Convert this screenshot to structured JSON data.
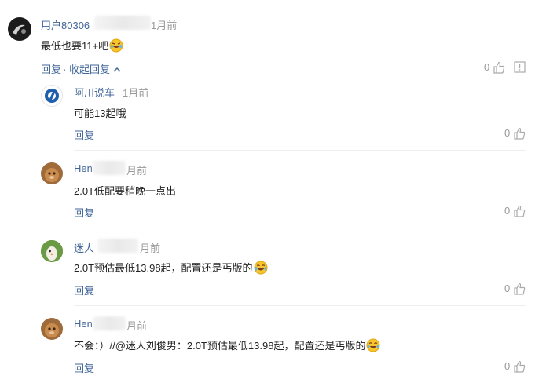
{
  "main_comment": {
    "user": "用户80306",
    "time": "1月前",
    "text": "最低也要11+吧",
    "reply_label": "回复",
    "collapse_label": "· 收起回复",
    "likes": "0"
  },
  "replies": [
    {
      "user": "阿川说车",
      "time": "1月前",
      "text": "可能13起哦",
      "reply_label": "回复",
      "likes": "0"
    },
    {
      "user": "Hen",
      "time": "月前",
      "text": "2.0T低配要稍晚一点出",
      "reply_label": "回复",
      "likes": "0"
    },
    {
      "user": "迷人",
      "time": "月前",
      "text": "2.0T预估最低13.98起，配置还是丐版的",
      "reply_label": "回复",
      "likes": "0"
    },
    {
      "user": "Hen",
      "time": "月前",
      "text": "不会：）//@迷人刘俊男：2.0T预估最低13.98起，配置还是丐版的",
      "reply_label": "回复",
      "likes": "0"
    }
  ],
  "colors": {
    "link": "#406599",
    "muted": "#999999",
    "divider": "#eeeeee"
  },
  "icons": [
    "thumbs-up-icon",
    "report-icon",
    "chevron-up-icon",
    "laughing-emoji-icon",
    "crying-laugh-emoji-icon"
  ]
}
